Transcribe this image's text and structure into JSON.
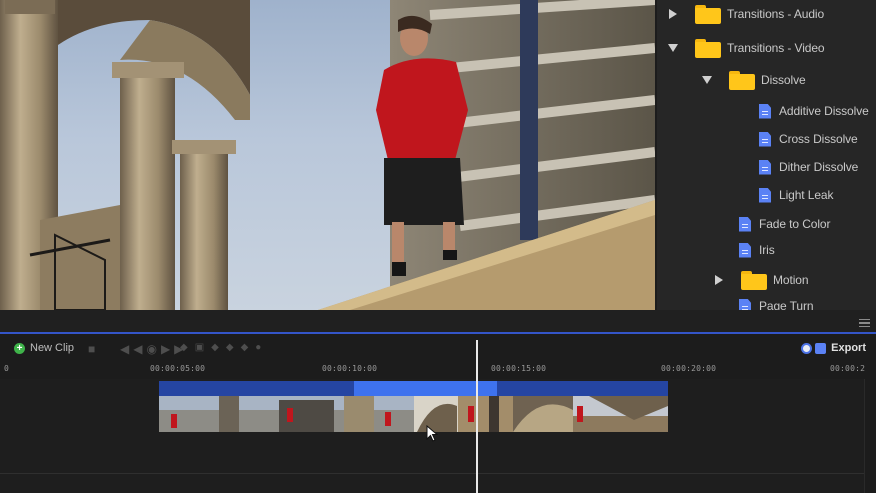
{
  "library": {
    "items": [
      {
        "label": "Transitions - Audio",
        "kind": "folder",
        "state": "collapsed",
        "icon": "folder-icon"
      },
      {
        "label": "Transitions - Video",
        "kind": "folder",
        "state": "expanded",
        "icon": "folder-icon"
      },
      {
        "label": "Dissolve",
        "kind": "folder",
        "state": "expanded",
        "icon": "folder-icon"
      },
      {
        "label": "Additive Dissolve",
        "kind": "file",
        "icon": "file-icon"
      },
      {
        "label": "Cross Dissolve",
        "kind": "file",
        "icon": "file-icon"
      },
      {
        "label": "Dither Dissolve",
        "kind": "file",
        "icon": "file-icon"
      },
      {
        "label": "Light Leak",
        "kind": "file",
        "icon": "file-icon"
      },
      {
        "label": "Fade to Color",
        "kind": "file",
        "icon": "file-icon"
      },
      {
        "label": "Iris",
        "kind": "file",
        "icon": "file-icon"
      },
      {
        "label": "Motion",
        "kind": "folder",
        "state": "collapsed",
        "icon": "folder-icon"
      },
      {
        "label": "Page Turn",
        "kind": "file",
        "icon": "file-icon"
      }
    ]
  },
  "toolbar": {
    "new_clip_label": "New Clip",
    "export_label": "Export"
  },
  "ruler": {
    "ticks": [
      "0",
      "00:00:05:00",
      "00:00:10:00",
      "00:00:15:00",
      "00:00:20:00",
      "00:00:2"
    ]
  },
  "colors": {
    "accent": "#3e72ee",
    "clip_header": "#2545a2",
    "folder": "#ffc61a",
    "file": "#5b82f5",
    "add_green": "#3fb34a"
  }
}
